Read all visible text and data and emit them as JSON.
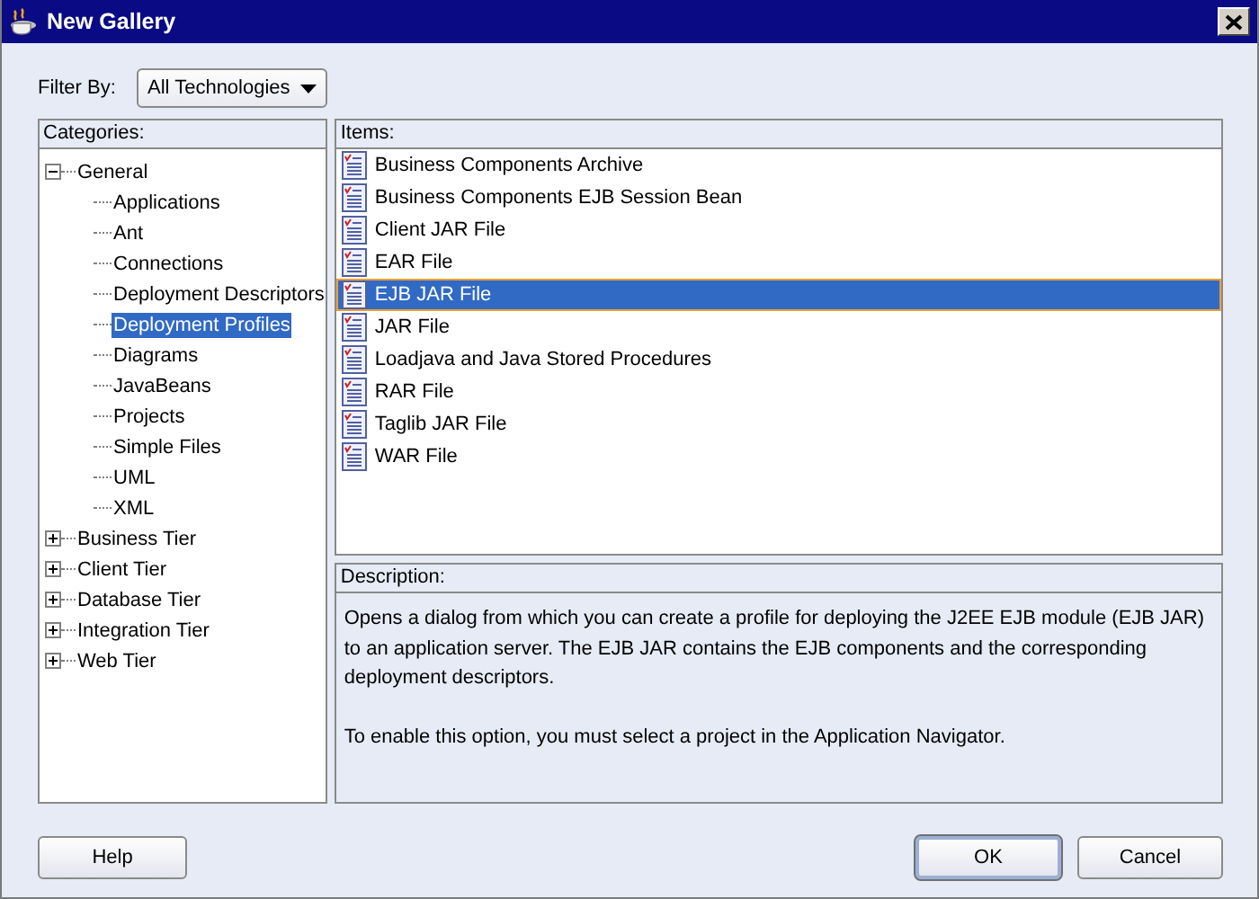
{
  "window": {
    "title": "New Gallery"
  },
  "filter": {
    "label": "Filter By:",
    "value": "All Technologies"
  },
  "categories": {
    "label": "Categories:",
    "tree": [
      {
        "label": "General",
        "expanded": true,
        "selected": false,
        "children": [
          {
            "label": "Applications",
            "selected": false
          },
          {
            "label": "Ant",
            "selected": false
          },
          {
            "label": "Connections",
            "selected": false
          },
          {
            "label": "Deployment Descriptors",
            "selected": false
          },
          {
            "label": "Deployment Profiles",
            "selected": true
          },
          {
            "label": "Diagrams",
            "selected": false
          },
          {
            "label": "JavaBeans",
            "selected": false
          },
          {
            "label": "Projects",
            "selected": false
          },
          {
            "label": "Simple Files",
            "selected": false
          },
          {
            "label": "UML",
            "selected": false
          },
          {
            "label": "XML",
            "selected": false
          }
        ]
      },
      {
        "label": "Business Tier",
        "expanded": false,
        "selected": false
      },
      {
        "label": "Client Tier",
        "expanded": false,
        "selected": false
      },
      {
        "label": "Database Tier",
        "expanded": false,
        "selected": false
      },
      {
        "label": "Integration Tier",
        "expanded": false,
        "selected": false
      },
      {
        "label": "Web Tier",
        "expanded": false,
        "selected": false
      }
    ]
  },
  "items": {
    "label": "Items:",
    "rows": [
      {
        "label": "Business Components Archive",
        "selected": false
      },
      {
        "label": "Business Components EJB Session Bean",
        "selected": false
      },
      {
        "label": "Client JAR File",
        "selected": false
      },
      {
        "label": "EAR File",
        "selected": false
      },
      {
        "label": "EJB JAR File",
        "selected": true
      },
      {
        "label": "JAR File",
        "selected": false
      },
      {
        "label": "Loadjava and Java Stored Procedures",
        "selected": false
      },
      {
        "label": "RAR File",
        "selected": false
      },
      {
        "label": "Taglib JAR File",
        "selected": false
      },
      {
        "label": "WAR File",
        "selected": false
      }
    ]
  },
  "description": {
    "label": "Description:",
    "paragraphs": [
      "Opens a dialog from which you can create a profile for deploying the J2EE EJB module (EJB JAR) to an application server. The EJB JAR contains the EJB components and the corresponding deployment descriptors.",
      "To enable this option, you must select a project in the Application Navigator."
    ]
  },
  "buttons": [
    {
      "label": "Help",
      "default": false
    },
    {
      "label": "OK",
      "default": true
    },
    {
      "label": "Cancel",
      "default": false
    }
  ]
}
